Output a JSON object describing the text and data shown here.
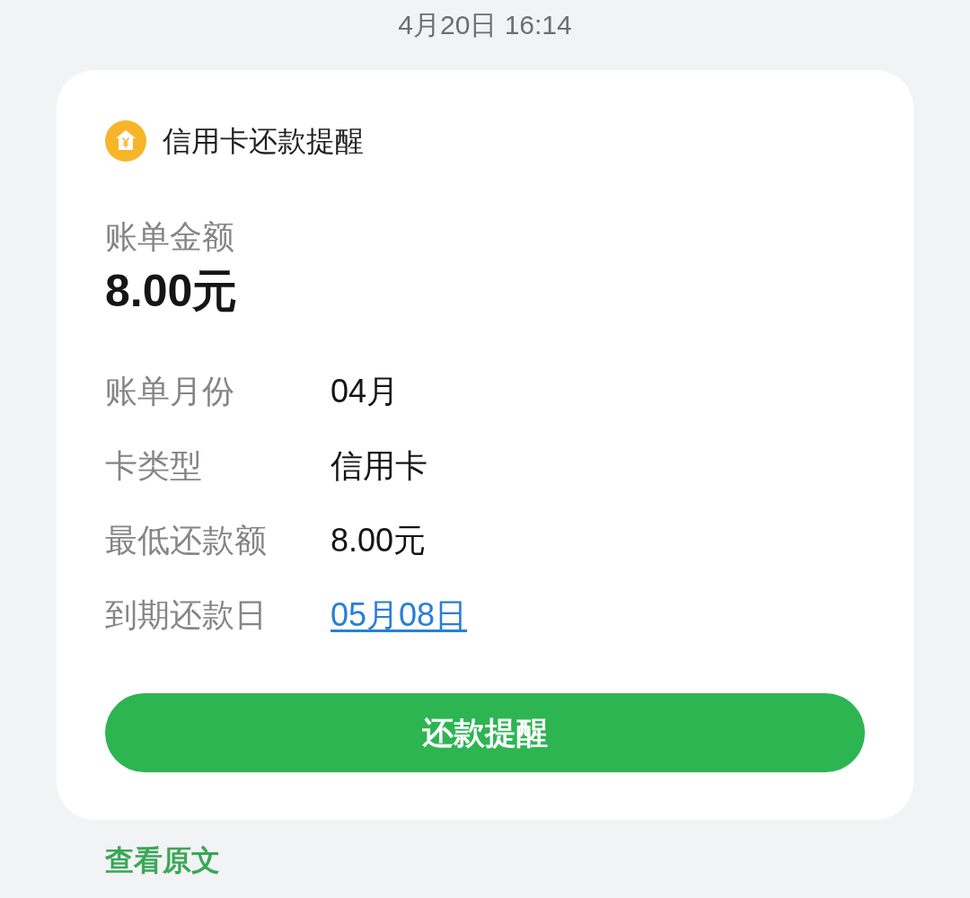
{
  "timestamp": "4月20日 16:14",
  "card": {
    "title": "信用卡还款提醒",
    "amount_label": "账单金额",
    "amount": "8.00元",
    "details": [
      {
        "label": "账单月份",
        "value": "04月",
        "kind": "text"
      },
      {
        "label": "卡类型",
        "value": "信用卡",
        "kind": "text"
      },
      {
        "label": "最低还款额",
        "value": "8.00元",
        "kind": "text"
      },
      {
        "label": "到期还款日",
        "value": "05月08日",
        "kind": "link"
      }
    ],
    "button": "还款提醒"
  },
  "view_original": "查看原文"
}
